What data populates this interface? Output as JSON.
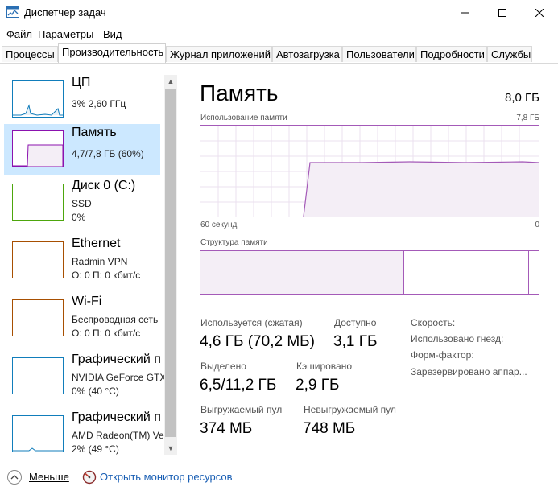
{
  "window": {
    "title": "Диспетчер задач"
  },
  "menu": [
    {
      "label": "Файл"
    },
    {
      "label": "Параметры"
    },
    {
      "label": "Вид"
    }
  ],
  "tabs": [
    {
      "label": "Процессы",
      "active": false
    },
    {
      "label": "Производительность",
      "active": true
    },
    {
      "label": "Журнал приложений",
      "active": false
    },
    {
      "label": "Автозагрузка",
      "active": false
    },
    {
      "label": "Пользователи",
      "active": false
    },
    {
      "label": "Подробности",
      "active": false
    },
    {
      "label": "Службы",
      "active": false
    }
  ],
  "sidebar": {
    "items": [
      {
        "name": "ЦП",
        "line1": "3% 2,60 ГГц",
        "line2": "",
        "color": "#117dbb",
        "selected": false
      },
      {
        "name": "Память",
        "line1": "4,7/7,8 ГБ (60%)",
        "line2": "",
        "color": "#8b12ae",
        "selected": true
      },
      {
        "name": "Диск 0 (C:)",
        "line1": "SSD",
        "line2": "0%",
        "color": "#4da60c",
        "selected": false
      },
      {
        "name": "Ethernet",
        "line1": "Radmin VPN",
        "line2": "О: 0 П: 0 кбит/с",
        "color": "#a74f01",
        "selected": false
      },
      {
        "name": "Wi-Fi",
        "line1": "Беспроводная сеть",
        "line2": "О: 0 П: 0 кбит/с",
        "color": "#a74f01",
        "selected": false
      },
      {
        "name": "Графический п",
        "line1": "NVIDIA GeForce GTX",
        "line2": "0% (40 °C)",
        "color": "#117dbb",
        "selected": false
      },
      {
        "name": "Графический п",
        "line1": "AMD Radeon(TM) Ve",
        "line2": "2% (49 °C)",
        "color": "#117dbb",
        "selected": false
      }
    ]
  },
  "main": {
    "title": "Память",
    "total": "8,0 ГБ",
    "usage_caption": "Использование памяти",
    "usage_max": "7,8 ГБ",
    "axis_left": "60 секунд",
    "axis_right": "0",
    "struct_caption": "Структура памяти",
    "stats": {
      "in_use_label": "Используется (сжатая)",
      "in_use_value": "4,6 ГБ (70,2 МБ)",
      "available_label": "Доступно",
      "available_value": "3,1 ГБ",
      "committed_label": "Выделено",
      "committed_value": "6,5/11,2 ГБ",
      "cached_label": "Кэшировано",
      "cached_value": "2,9 ГБ",
      "paged_label": "Выгружаемый пул",
      "paged_value": "374 МБ",
      "nonpaged_label": "Невыгружаемый пул",
      "nonpaged_value": "748 МБ"
    },
    "right_labels": {
      "speed": "Скорость:",
      "slots": "Использовано гнезд:",
      "form": "Форм-фактор:",
      "reserved": "Зарезервировано аппар..."
    }
  },
  "footer": {
    "less": "Меньше",
    "monitor": "Открыть монитор ресурсов"
  },
  "colors": {
    "memory_accent": "#a45ab8",
    "memory_fill": "#f4eef6",
    "selection": "#cce8ff",
    "link": "#1a5fb4"
  },
  "icons": {
    "app": "task-manager-icon",
    "less": "chevron-up-icon",
    "monitor": "resource-monitor-icon"
  }
}
